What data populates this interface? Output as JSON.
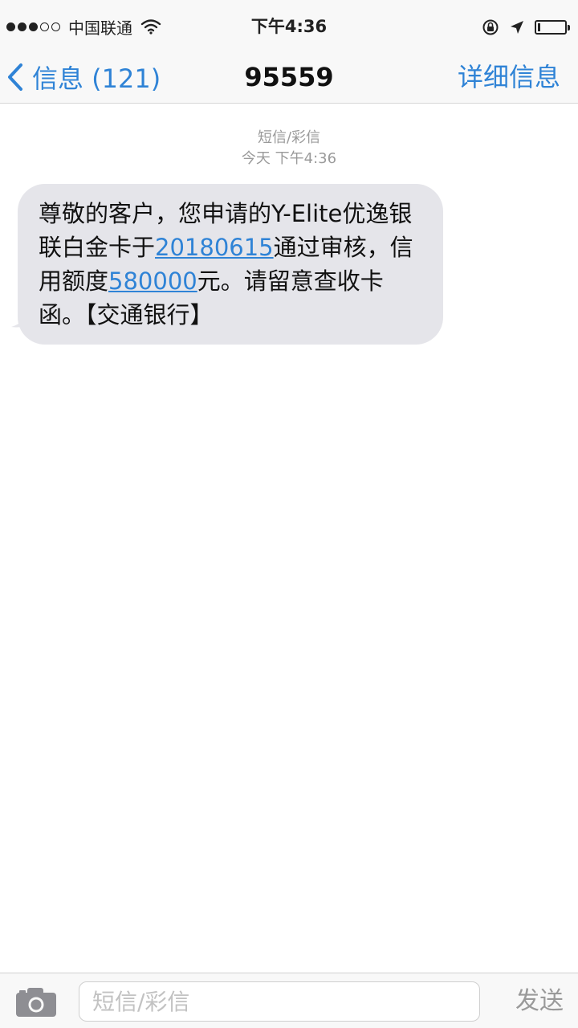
{
  "status_bar": {
    "carrier": "中国联通",
    "time": "下午4:36",
    "signal_bars_filled": 3,
    "signal_bars_total": 5,
    "icons": [
      "signal-dots",
      "wifi-icon",
      "lock-rotation-icon",
      "location-arrow-icon",
      "battery-icon"
    ]
  },
  "nav": {
    "back_label": "信息 (121)",
    "title": "95559",
    "details_label": "详细信息"
  },
  "conversation": {
    "meta_type": "短信/彩信",
    "meta_time": "今天 下午4:36",
    "message": {
      "part1": "尊敬的客户，您申请的Y-Elite优逸银联白金卡于",
      "date_link": "20180615",
      "part2": "通过审核，信用额度",
      "amount_link": "580000",
      "part3": "元。请留意查收卡函。【交通银行】"
    }
  },
  "input_bar": {
    "placeholder": "短信/彩信",
    "send_label": "发送"
  },
  "colors": {
    "accent": "#2f83d6",
    "bubble": "#e5e5ea",
    "bar_background": "#f8f8f8",
    "meta_text": "#9a9a9a"
  }
}
